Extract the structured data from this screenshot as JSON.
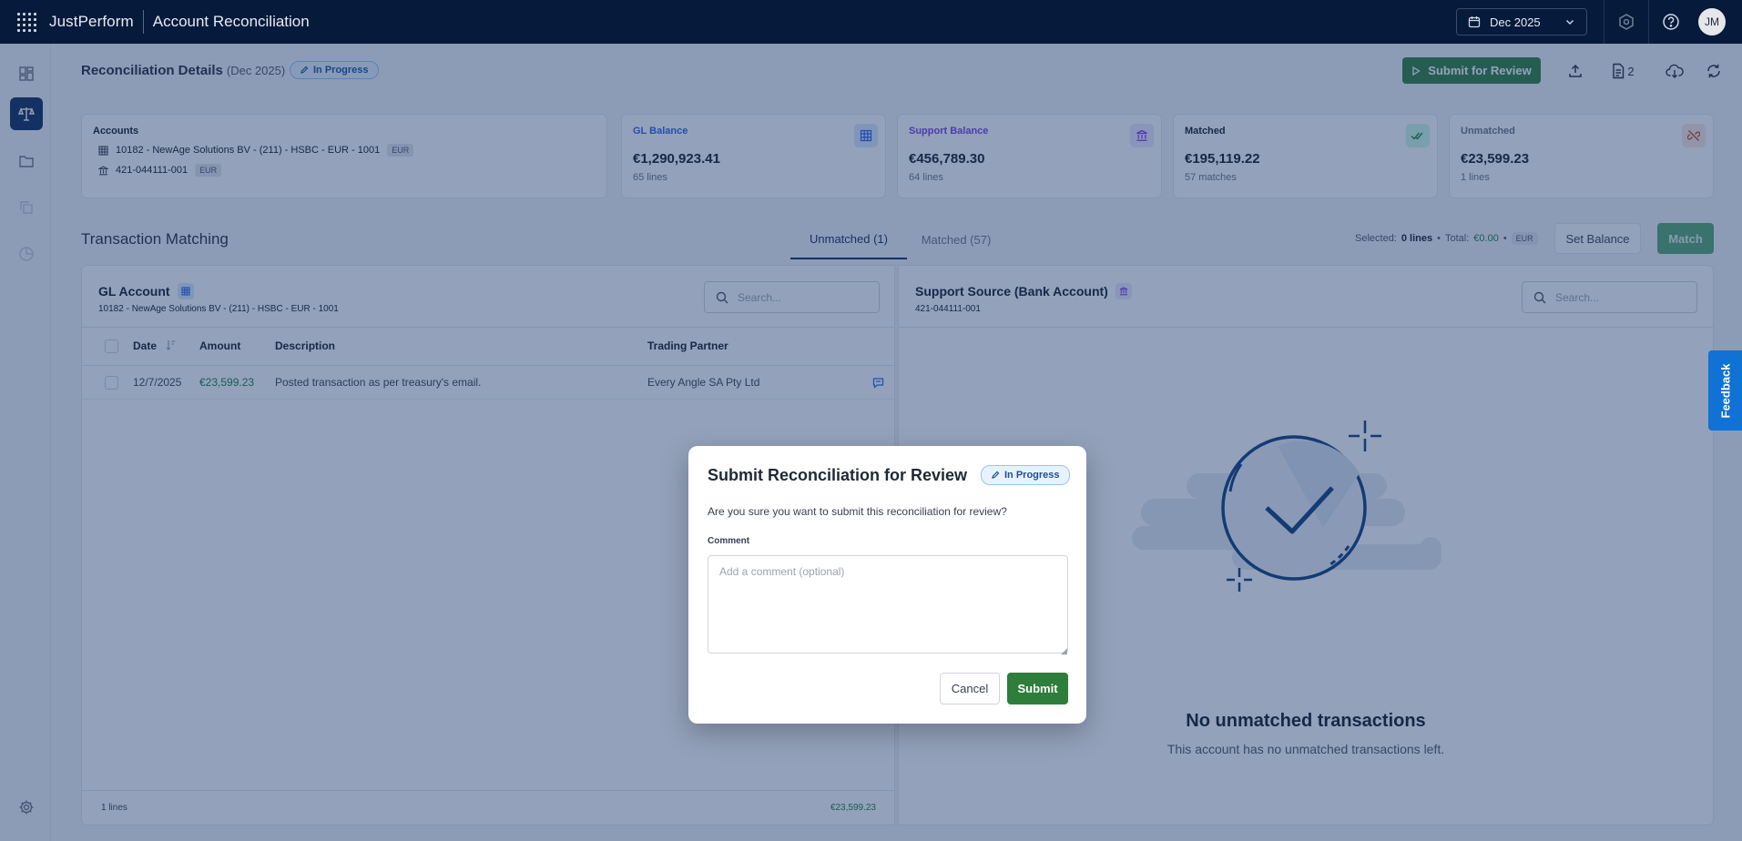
{
  "app": {
    "brand": "JustPerform",
    "title": "Account Reconciliation",
    "period": "Dec 2025",
    "user_initials": "JM"
  },
  "page": {
    "title": "Reconciliation Details",
    "period_label": "(Dec 2025)",
    "status": "In Progress",
    "submit_label": "Submit for Review",
    "attachments_count": "2"
  },
  "accounts": {
    "title": "Accounts",
    "gl_account": "10182 - NewAge Solutions BV - (211) - HSBC - EUR - 1001",
    "gl_currency": "EUR",
    "bank_account": "421-044111-001",
    "bank_currency": "EUR"
  },
  "metrics": [
    {
      "label": "GL Balance",
      "value": "€1,290,923.41",
      "sub": "65 lines",
      "color": "#2563eb"
    },
    {
      "label": "Support Balance",
      "value": "€456,789.30",
      "sub": "64 lines",
      "color": "#7c3aed"
    },
    {
      "label": "Matched",
      "value": "€195,119.22",
      "sub": "57 matches",
      "color": "#111827"
    },
    {
      "label": "Unmatched",
      "value": "€23,599.23",
      "sub": "1 lines",
      "color": "#6b7280"
    }
  ],
  "matching": {
    "title": "Transaction Matching",
    "tabs": [
      {
        "label": "Unmatched (1)",
        "active": true
      },
      {
        "label": "Matched (57)",
        "active": false
      }
    ],
    "selected_label": "Selected:",
    "selected_value": "0 lines",
    "total_label": "Total:",
    "total_value": "€0.00",
    "total_currency": "EUR",
    "set_balance_label": "Set Balance",
    "match_label": "Match"
  },
  "gl_panel": {
    "title": "GL Account",
    "subtitle": "10182 - NewAge Solutions BV - (211) - HSBC - EUR - 1001",
    "search_placeholder": "Search...",
    "columns": [
      "Date",
      "Amount",
      "Description",
      "Trading Partner"
    ],
    "rows": [
      {
        "date": "12/7/2025",
        "amount": "€23,599.23",
        "description": "Posted transaction as per treasury's email.",
        "partner": "Every Angle SA Pty Ltd"
      }
    ],
    "footer_lines": "1 lines",
    "footer_total": "€23,599.23"
  },
  "support_panel": {
    "title": "Support Source (Bank Account)",
    "subtitle": "421-044111-001",
    "search_placeholder": "Search...",
    "empty_title": "No unmatched transactions",
    "empty_sub": "This account has no unmatched transactions left."
  },
  "feedback_label": "Feedback",
  "modal": {
    "title": "Submit Reconciliation for Review",
    "status": "In Progress",
    "question": "Are you sure you want to submit this reconciliation for review?",
    "comment_label": "Comment",
    "comment_placeholder": "Add a comment (optional)",
    "cancel_label": "Cancel",
    "submit_label": "Submit"
  }
}
